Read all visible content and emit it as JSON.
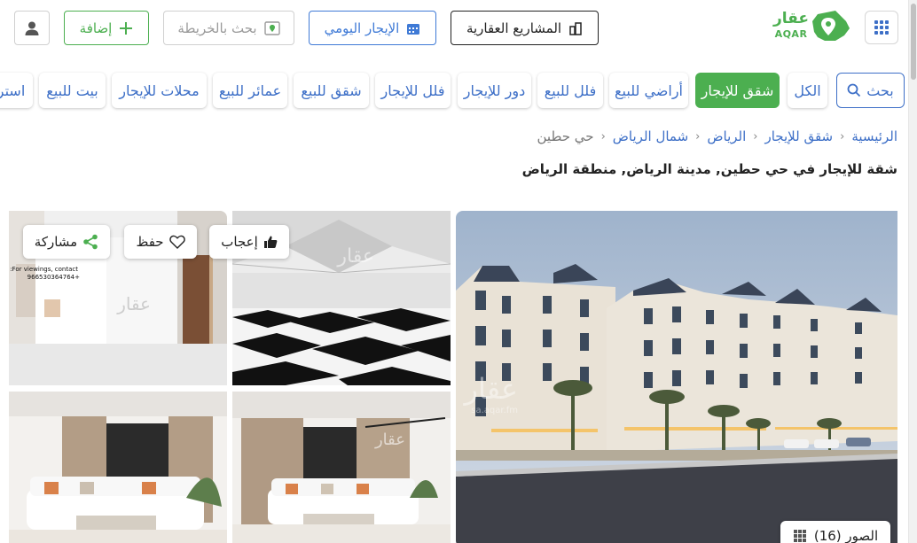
{
  "brand": {
    "name_ar": "عقار",
    "name_en": "AQAR",
    "color": "#4caf50"
  },
  "header": {
    "projects_label": "المشاريع العقارية",
    "daily_rent_label": "الإيجار اليومي",
    "map_search_label": "بحث بالخريطة",
    "add_label": "إضافة",
    "icons": {
      "menu": "grid-icon",
      "projects": "buildings-icon",
      "daily_rent": "calendar-icon",
      "map": "map-icon",
      "add": "plus-icon",
      "user": "user-icon"
    }
  },
  "filters": {
    "search_label": "بحث",
    "items": [
      "الكل",
      "شقق للإيجار",
      "أراضي للبيع",
      "فلل للبيع",
      "دور للإيجار",
      "فلل للإيجار",
      "شقق للبيع",
      "عمائر للبيع",
      "محلات للإيجار",
      "بيت للبيع",
      "استر"
    ],
    "active": "شقق للإيجار"
  },
  "breadcrumb": [
    "الرئيسية",
    "شقق للإيجار",
    "الرياض",
    "شمال الرياض",
    "حي حطين"
  ],
  "listing": {
    "title": "شقة للإيجار في حي حطين, مدينة الرياض, منطقة الرياض"
  },
  "actions": {
    "like_label": "إعجاب",
    "save_label": "حفظ",
    "share_label": "مشاركة"
  },
  "gallery": {
    "count_label": "الصور (16)",
    "watermark": "عقار",
    "watermark_url": "sa.aqar.fm",
    "viewing_text_line1": "For viewings, contact:",
    "viewing_text_line2": "+966530364764"
  },
  "colors": {
    "accent_green": "#4caf50",
    "link_blue": "#3d6fc7",
    "text_dark": "#222222"
  }
}
